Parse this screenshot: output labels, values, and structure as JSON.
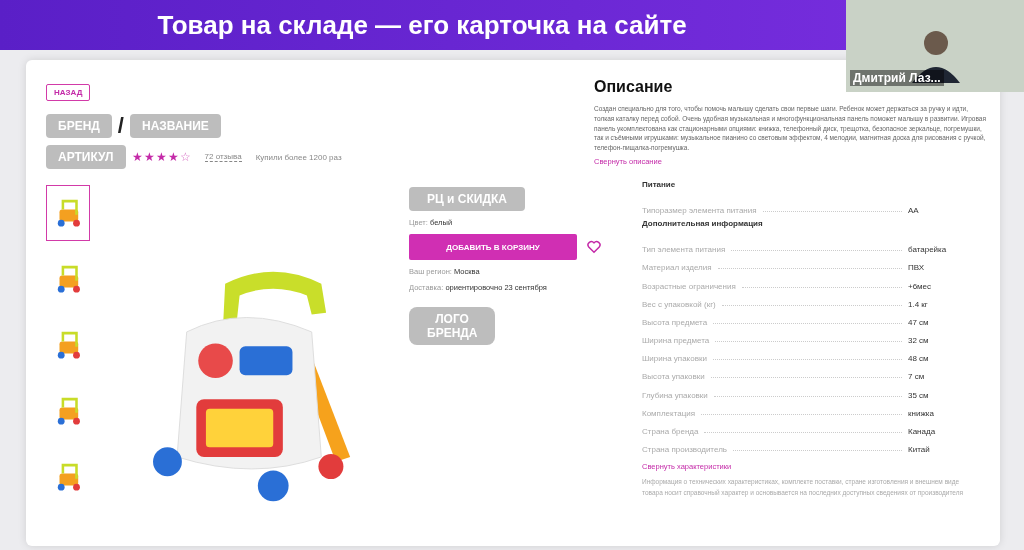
{
  "slide": {
    "title": "Товар на складе — его карточка на сайте"
  },
  "video": {
    "name": "Дмитрий Лаз..."
  },
  "product": {
    "back": "НАЗАД",
    "brand": "БРЕНД",
    "separator": "/",
    "name": "НАЗВАНИЕ",
    "article": "АРТИКУЛ",
    "stars": 4,
    "reviews": "72 отзыва",
    "bought": "Купили более 1200 раз",
    "thumbnails": [
      {
        "selected": true
      },
      {
        "selected": false
      },
      {
        "selected": false
      },
      {
        "selected": false
      },
      {
        "selected": false
      }
    ],
    "price": "РЦ и СКИДКА",
    "color_label": "Цвет:",
    "color_value": "белый",
    "cart_button": "ДОБАВИТЬ В КОРЗИНУ",
    "region_label": "Ваш регион:",
    "region_value": "Москва",
    "delivery_label": "Доставка:",
    "delivery_value": "ориентировочно 23 сентября",
    "brand_logo": "ЛОГО БРЕНДА"
  },
  "description": {
    "heading": "Описание",
    "text": "Создан специально для того, чтобы помочь малышу сделать свои первые шаги. Ребенок может держаться за ручку и идти, толкая каталку перед собой. Очень удобная музыкальная и многофункциональная панель поможет малышу в развитии. Игровая панель укомплектована как стационарными опциями: книжка, телефонный диск, трещотка, безопасное зеркальце, погремушки, так и съёмными игрушками: музыкальное пианино со световым эффектом, 4 мелодии, магнитная доска для рисования с ручкой, телефон-пищалка-погремушка.",
    "collapse": "Свернуть описание"
  },
  "specs": {
    "groups": [
      {
        "title": "Питание",
        "rows": [
          {
            "name": "Типоразмер элемента питания",
            "value": "AA"
          }
        ]
      },
      {
        "title": "Дополнительная информация",
        "rows": [
          {
            "name": "Тип элемента питания",
            "value": "батарейка"
          },
          {
            "name": "Материал изделия",
            "value": "ПВХ"
          },
          {
            "name": "Возрастные ограничения",
            "value": "+6мес"
          },
          {
            "name": "Вес с упаковкой (кг)",
            "value": "1.4 кг"
          },
          {
            "name": "Высота предмета",
            "value": "47 см"
          },
          {
            "name": "Ширина предмета",
            "value": "32 см"
          },
          {
            "name": "Ширина упаковки",
            "value": "48 см"
          },
          {
            "name": "Высота упаковки",
            "value": "7 см"
          },
          {
            "name": "Глубина упаковки",
            "value": "35 см"
          },
          {
            "name": "Комплектация",
            "value": "книжка"
          },
          {
            "name": "Страна бренда",
            "value": "Канада"
          },
          {
            "name": "Страна производитель",
            "value": "Китай"
          }
        ]
      }
    ],
    "collapse": "Свернуть характеристики",
    "note": "Информация о технических характеристиках, комплекте поставки, стране изготовления и внешнем виде товара носит справочный характер и основывается на последних доступных сведениях от производителя"
  }
}
